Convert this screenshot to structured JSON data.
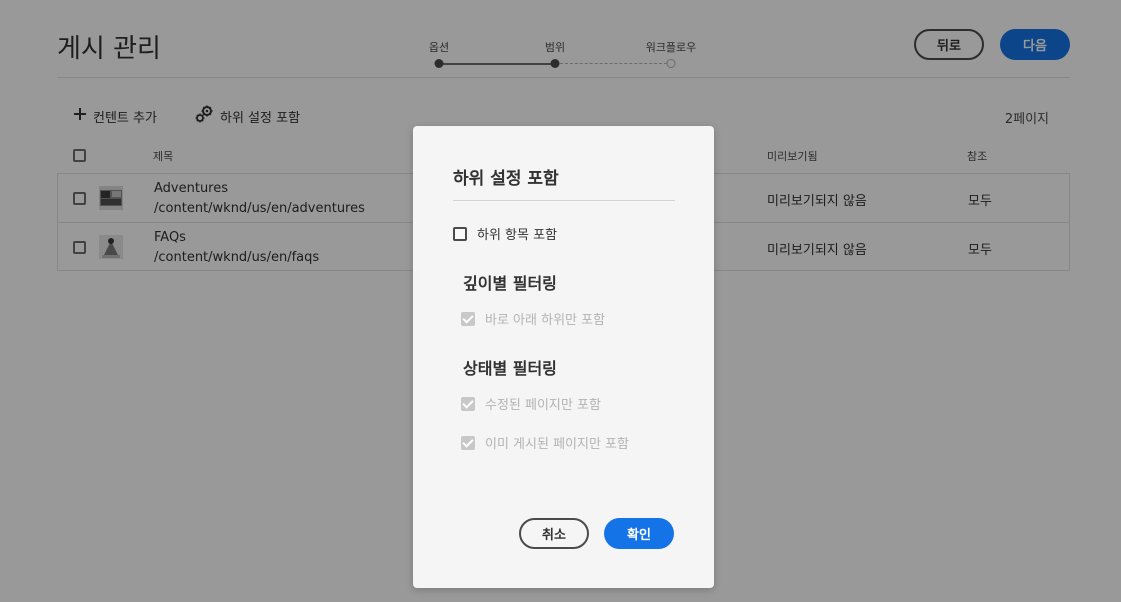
{
  "page": {
    "title": "게시 관리"
  },
  "stepper": {
    "steps": [
      {
        "label": "옵션",
        "state": "done"
      },
      {
        "label": "범위",
        "state": "current"
      },
      {
        "label": "워크플로우",
        "state": "todo"
      }
    ]
  },
  "header": {
    "back_label": "뒤로",
    "next_label": "다음"
  },
  "toolbar": {
    "add_content_label": "컨텐트 추가",
    "include_children_label": "하위 설정 포함",
    "page_count": "2페이지"
  },
  "table": {
    "headers": {
      "title": "제목",
      "preview": "미리보기됨",
      "reference": "참조"
    },
    "rows": [
      {
        "title": "Adventures",
        "path": "/content/wknd/us/en/adventures",
        "preview": "미리보기되지 않음",
        "reference": "모두"
      },
      {
        "title": "FAQs",
        "path": "/content/wknd/us/en/faqs",
        "preview": "미리보기되지 않음",
        "reference": "모두"
      }
    ]
  },
  "dialog": {
    "title": "하위 설정 포함",
    "include_children_label": "하위 항목 포함",
    "depth_heading": "깊이별 필터링",
    "direct_children_label": "바로 아래 하위만 포함",
    "status_heading": "상태별 필터링",
    "modified_only_label": "수정된 페이지만 포함",
    "published_only_label": "이미 게시된 페이지만 포함",
    "cancel_label": "취소",
    "confirm_label": "확인"
  },
  "colors": {
    "accent": "#1473e6",
    "overlay": "rgba(0,0,0,0.4)",
    "dialog_bg": "#f5f5f5"
  },
  "icons": {
    "add": "plus-icon",
    "include_children": "gears-icon"
  }
}
